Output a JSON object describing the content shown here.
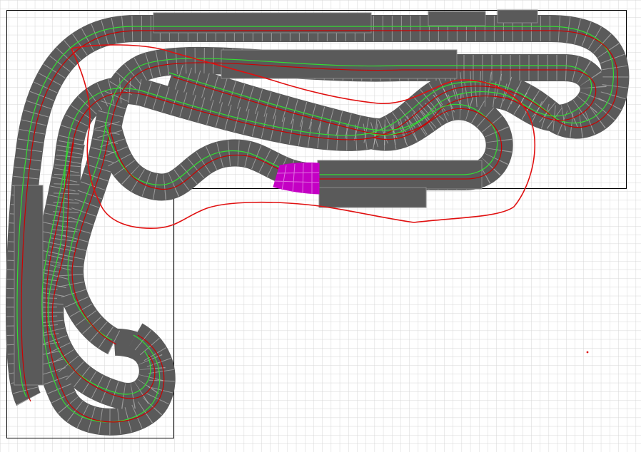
{
  "editor": {
    "background_color": "#ffffff",
    "grid_color": "#d6d6d6",
    "board_outline_color": "#000000",
    "track_color": "#5a5a5a",
    "tile_seam_color": "#cfcfcf",
    "tile_edge_color": "#8a8a8a",
    "lane_green_color": "#33dd33",
    "lane_red_color": "#cc0000",
    "selected_piece_color": "#c400c4",
    "planning_line_color": "#e01010"
  },
  "icons": {
    "marker": "dot-icon"
  }
}
